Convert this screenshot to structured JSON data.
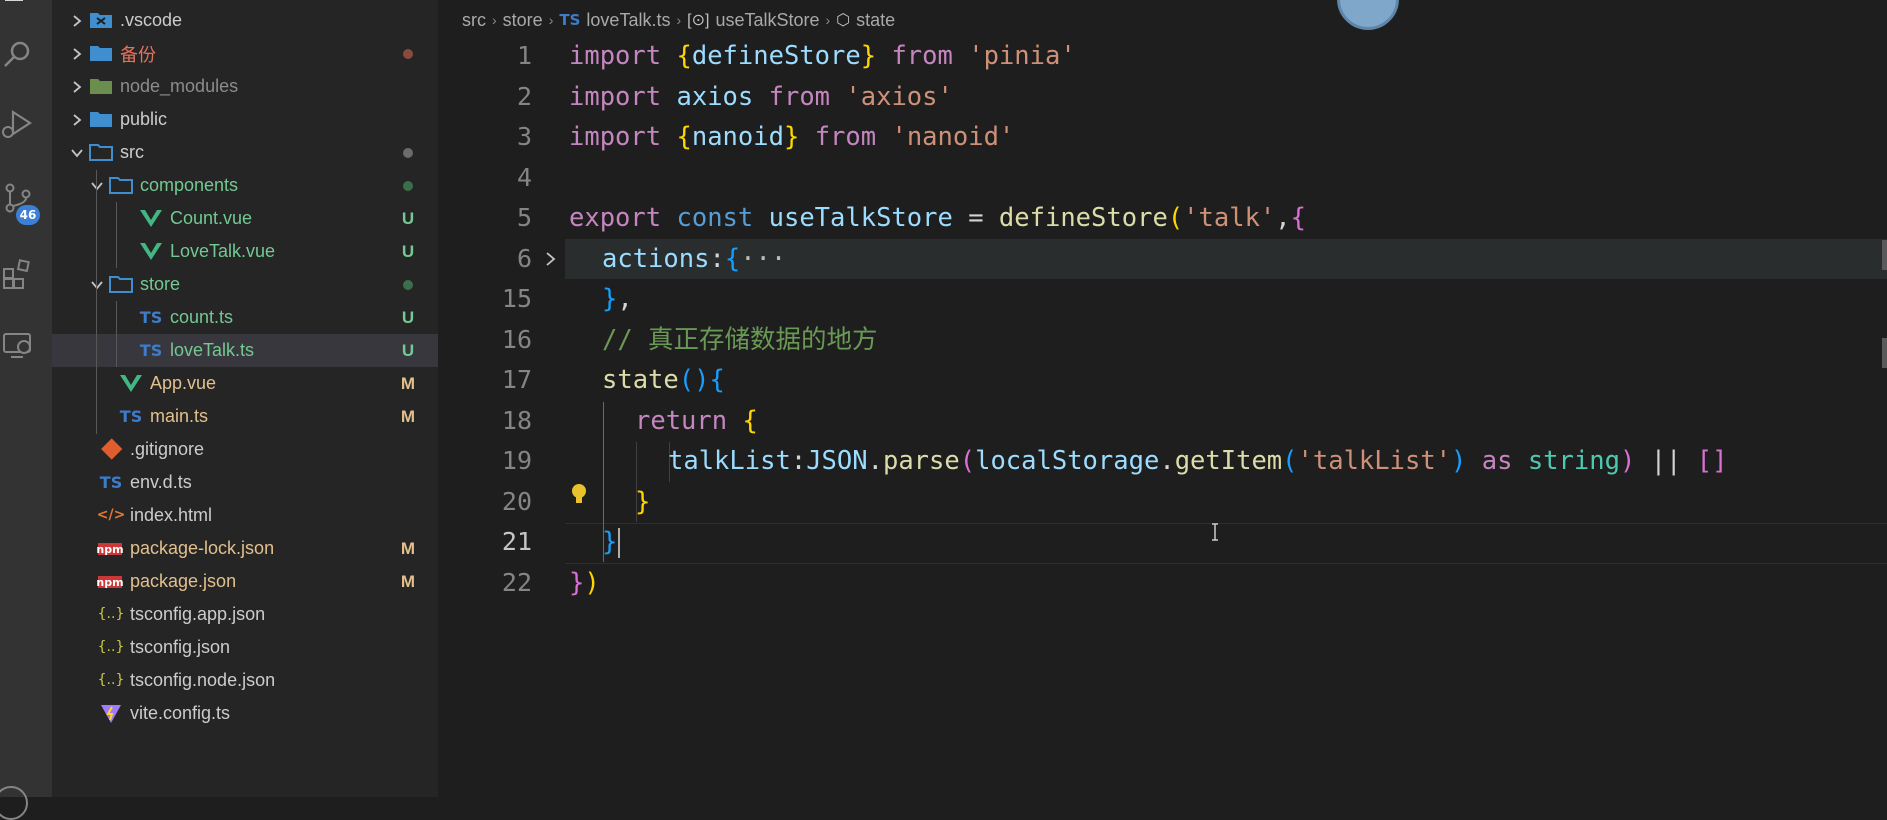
{
  "activity_bar": {
    "icons": [
      "explorer-icon",
      "search-icon",
      "run-debug-icon",
      "source-control-icon",
      "extensions-icon",
      "remote-explorer-icon"
    ],
    "source_control_badge": "46"
  },
  "explorer": {
    "items": [
      {
        "name": ".vscode",
        "icon": "vscode-folder-icon",
        "status": "",
        "color": "#cccccc"
      },
      {
        "name": "备份",
        "icon": "folder-icon",
        "status": "dot",
        "color": "#e2725b"
      },
      {
        "name": "node_modules",
        "icon": "node-folder-icon",
        "status": "",
        "color": "#8c8c8c"
      },
      {
        "name": "public",
        "icon": "folder-icon",
        "status": "",
        "color": "#cccccc"
      },
      {
        "name": "src",
        "icon": "folder-open-icon",
        "status": "dot",
        "color": "#cccccc"
      },
      {
        "name": "components",
        "icon": "folder-open-icon",
        "status": "dot",
        "color": "#73c991"
      },
      {
        "name": "Count.vue",
        "icon": "vue-icon",
        "status": "U",
        "color": "#73c991"
      },
      {
        "name": "LoveTalk.vue",
        "icon": "vue-icon",
        "status": "U",
        "color": "#73c991"
      },
      {
        "name": "store",
        "icon": "folder-open-icon",
        "status": "dot",
        "color": "#73c991"
      },
      {
        "name": "count.ts",
        "icon": "ts-icon",
        "status": "U",
        "color": "#73c991"
      },
      {
        "name": "loveTalk.ts",
        "icon": "ts-icon",
        "status": "U",
        "color": "#73c991"
      },
      {
        "name": "App.vue",
        "icon": "vue-icon",
        "status": "M",
        "color": "#e2c08d"
      },
      {
        "name": "main.ts",
        "icon": "ts-icon",
        "status": "M",
        "color": "#e2c08d"
      },
      {
        "name": ".gitignore",
        "icon": "git-icon",
        "status": "",
        "color": "#cccccc"
      },
      {
        "name": "env.d.ts",
        "icon": "ts-icon",
        "status": "",
        "color": "#cccccc"
      },
      {
        "name": "index.html",
        "icon": "html-icon",
        "status": "",
        "color": "#cccccc"
      },
      {
        "name": "package-lock.json",
        "icon": "npm-icon",
        "status": "M",
        "color": "#e2c08d"
      },
      {
        "name": "package.json",
        "icon": "npm-icon",
        "status": "M",
        "color": "#e2c08d"
      },
      {
        "name": "tsconfig.app.json",
        "icon": "json-icon",
        "status": "",
        "color": "#cccccc"
      },
      {
        "name": "tsconfig.json",
        "icon": "json-icon",
        "status": "",
        "color": "#cccccc"
      },
      {
        "name": "tsconfig.node.json",
        "icon": "json-icon",
        "status": "",
        "color": "#cccccc"
      },
      {
        "name": "vite.config.ts",
        "icon": "vite-icon",
        "status": "",
        "color": "#cccccc"
      }
    ],
    "ts_label": "TS",
    "npm_label": "npm",
    "json_label": "{..}",
    "html_label": "</>"
  },
  "breadcrumb": {
    "src": "src",
    "store": "store",
    "ts_badge": "TS",
    "file": "loveTalk.ts",
    "symbol1": "useTalkStore",
    "symbol2": "state"
  },
  "editor": {
    "line_numbers": [
      "1",
      "2",
      "3",
      "4",
      "5",
      "6",
      "15",
      "16",
      "17",
      "18",
      "19",
      "20",
      "21",
      "22"
    ],
    "code": {
      "l1": {
        "kw": "import",
        "b1": "{",
        "name": "defineStore",
        "b2": "}",
        "from": "from",
        "str": "'pinia'"
      },
      "l2": {
        "kw": "import",
        "name": "axios",
        "from": "from",
        "str": "'axios'"
      },
      "l3": {
        "kw": "import",
        "b1": "{",
        "name": "nanoid",
        "b2": "}",
        "from": "from",
        "str": "'nanoid'"
      },
      "l5": {
        "export": "export",
        "const": "const",
        "name": "useTalkStore",
        "eq": "=",
        "fn": "defineStore",
        "paren": "(",
        "str": "'talk'",
        "comma": ",",
        "brace": "{"
      },
      "l6": {
        "prop": "actions",
        "colon": ":",
        "brace": "{",
        "ellipsis": "···"
      },
      "l15": {
        "brace": "}",
        "comma": ","
      },
      "l16": {
        "comment": "// 真正存储数据的地方"
      },
      "l17": {
        "fn": "state",
        "paren": "()",
        "brace": "{"
      },
      "l18": {
        "kw": "return",
        "brace": "{"
      },
      "l19": {
        "prop": "talkList",
        "colon": ":",
        "obj": "JSON",
        "dot1": ".",
        "m1": "parse",
        "p1": "(",
        "obj2": "localStorage",
        "dot2": ".",
        "m2": "getItem",
        "p2": "(",
        "str": "'talkList'",
        "p3": ")",
        "as": "as",
        "type": "string",
        "p4": ")",
        "or": "||",
        "arr": "[]"
      },
      "l20": {
        "brace": "}"
      },
      "l21": {
        "brace": "}"
      },
      "l22": {
        "brace": "}",
        "paren": ")"
      }
    }
  }
}
